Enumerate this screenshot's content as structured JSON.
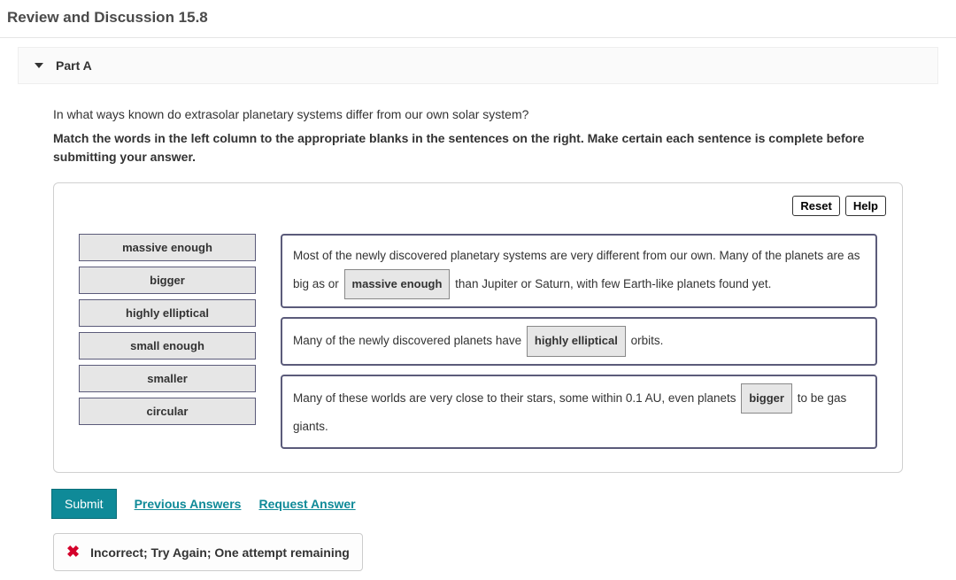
{
  "page": {
    "title": "Review and Discussion 15.8"
  },
  "part": {
    "label": "Part A"
  },
  "question": {
    "prompt": "In what ways known do extrasolar planetary systems differ from our own solar system?",
    "instruction": "Match the words in the left column to the appropriate blanks in the sentences on the right. Make certain each sentence is complete before submitting your answer."
  },
  "controls": {
    "reset": "Reset",
    "help": "Help"
  },
  "words": [
    "massive enough",
    "bigger",
    "highly elliptical",
    "small enough",
    "smaller",
    "circular"
  ],
  "sentences": [
    {
      "pre": "Most of the newly discovered planetary systems are very different from our own. Many of the planets are as big as or ",
      "chip": "massive enough",
      "post": " than Jupiter or Saturn, with few Earth-like planets found yet."
    },
    {
      "pre": "Many of the newly discovered planets have ",
      "chip": "highly elliptical",
      "post": " orbits."
    },
    {
      "pre": "Many of these worlds are very close to their stars, some within 0.1 AU, even planets ",
      "chip": "bigger",
      "post": " to be gas giants."
    }
  ],
  "actions": {
    "submit": "Submit",
    "previous": "Previous Answers",
    "request": "Request Answer"
  },
  "feedback": {
    "text": "Incorrect; Try Again; One attempt remaining"
  }
}
